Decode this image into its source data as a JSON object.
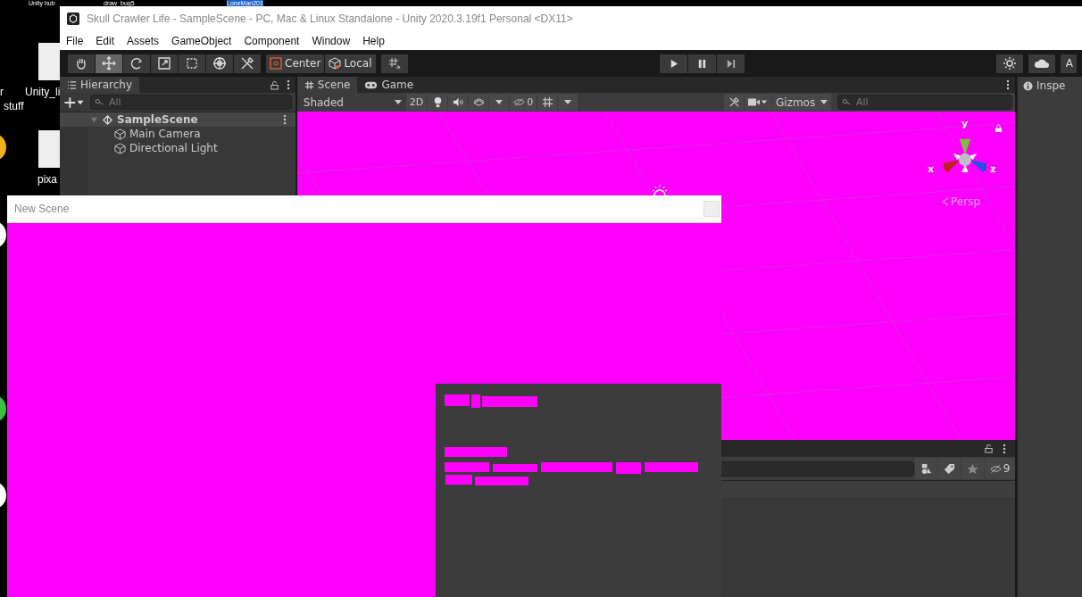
{
  "desktop": {
    "labels": [
      {
        "text": "Unity hub",
        "selected": false
      },
      {
        "text": "draw_bug5",
        "selected": false
      },
      {
        "text": "LoneMan201",
        "selected": true
      },
      {
        "text": "r",
        "selected": false
      },
      {
        "text": "stuff",
        "selected": false
      },
      {
        "text": "Unity_li",
        "selected": false
      },
      {
        "text": "pixa",
        "selected": false
      }
    ]
  },
  "window": {
    "title": "Skull Crawler Life - SampleScene - PC, Mac & Linux Standalone - Unity 2020.3.19f1 Personal <DX11>"
  },
  "menu": [
    "File",
    "Edit",
    "Assets",
    "GameObject",
    "Component",
    "Window",
    "Help"
  ],
  "toolbar": {
    "tools": [
      {
        "kind": "hand",
        "selected": false
      },
      {
        "kind": "move",
        "selected": true
      },
      {
        "kind": "rotate",
        "selected": false
      },
      {
        "kind": "scale",
        "selected": false
      },
      {
        "kind": "rect",
        "selected": false
      },
      {
        "kind": "transform",
        "selected": false
      },
      {
        "kind": "custom",
        "selected": false
      }
    ],
    "pivot": "Center",
    "space": "Local",
    "account": "A"
  },
  "hierarchy": {
    "tab": "Hierarchy",
    "search_placeholder": "All",
    "tree": [
      {
        "label": "SampleScene",
        "expanded": true,
        "children": [
          {
            "label": "Main Camera"
          },
          {
            "label": "Directional Light"
          }
        ]
      }
    ]
  },
  "scene_tabs": [
    {
      "label": "Scene",
      "kind": "scene",
      "selected": true
    },
    {
      "label": "Game",
      "kind": "game",
      "selected": false
    }
  ],
  "scene_toolbar": {
    "shading": "Shaded",
    "mode_2d": "2D",
    "hidden_count": "0",
    "gizmos": "Gizmos",
    "search_placeholder": "All"
  },
  "scene_view": {
    "projection": "Persp",
    "axes": [
      "y",
      "x",
      "z"
    ]
  },
  "inspector": {
    "tab": "Inspe"
  },
  "project": {
    "hidden_count": "9"
  },
  "new_scene": {
    "title": "New Scene"
  }
}
